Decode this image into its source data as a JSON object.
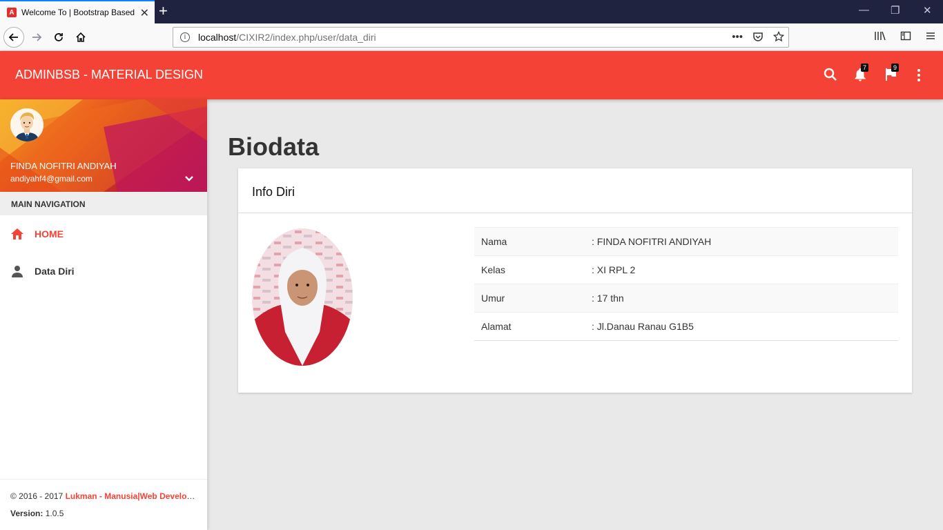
{
  "browser": {
    "tab_title": "Welcome To | Bootstrap Based",
    "favicon_letter": "A",
    "url_host": "localhost",
    "url_path": "/CIXIR2/index.php/user/data_diri"
  },
  "header": {
    "brand": "ADMINBSB - MATERIAL DESIGN",
    "notifications_count": "7",
    "tasks_count": "9"
  },
  "sidebar": {
    "user_name": "FINDA NOFITRI ANDIYAH",
    "user_email": "andiyahf4@gmail.com",
    "menu_header": "MAIN NAVIGATION",
    "items": [
      {
        "label": "HOME",
        "icon": "home-icon",
        "active": true
      },
      {
        "label": "Data Diri",
        "icon": "person-icon",
        "active": false
      }
    ],
    "legal": {
      "copyright_prefix": "© 2016 - 2017 ",
      "copyright_link": "Lukman - Manusia|Web Developer",
      "version_label": "Version:",
      "version_value": " 1.0.5"
    }
  },
  "main": {
    "page_title": "Biodata",
    "card_title": "Info Diri",
    "rows": [
      {
        "key": "Nama",
        "value": ": FINDA NOFITRI ANDIYAH"
      },
      {
        "key": "Kelas",
        "value": ": XI RPL 2"
      },
      {
        "key": "Umur",
        "value": ": 17 thn"
      },
      {
        "key": "Alamat",
        "value": ": Jl.Danau Ranau G1B5"
      }
    ]
  },
  "colors": {
    "accent": "#f44336",
    "browser_dark": "#202340"
  }
}
